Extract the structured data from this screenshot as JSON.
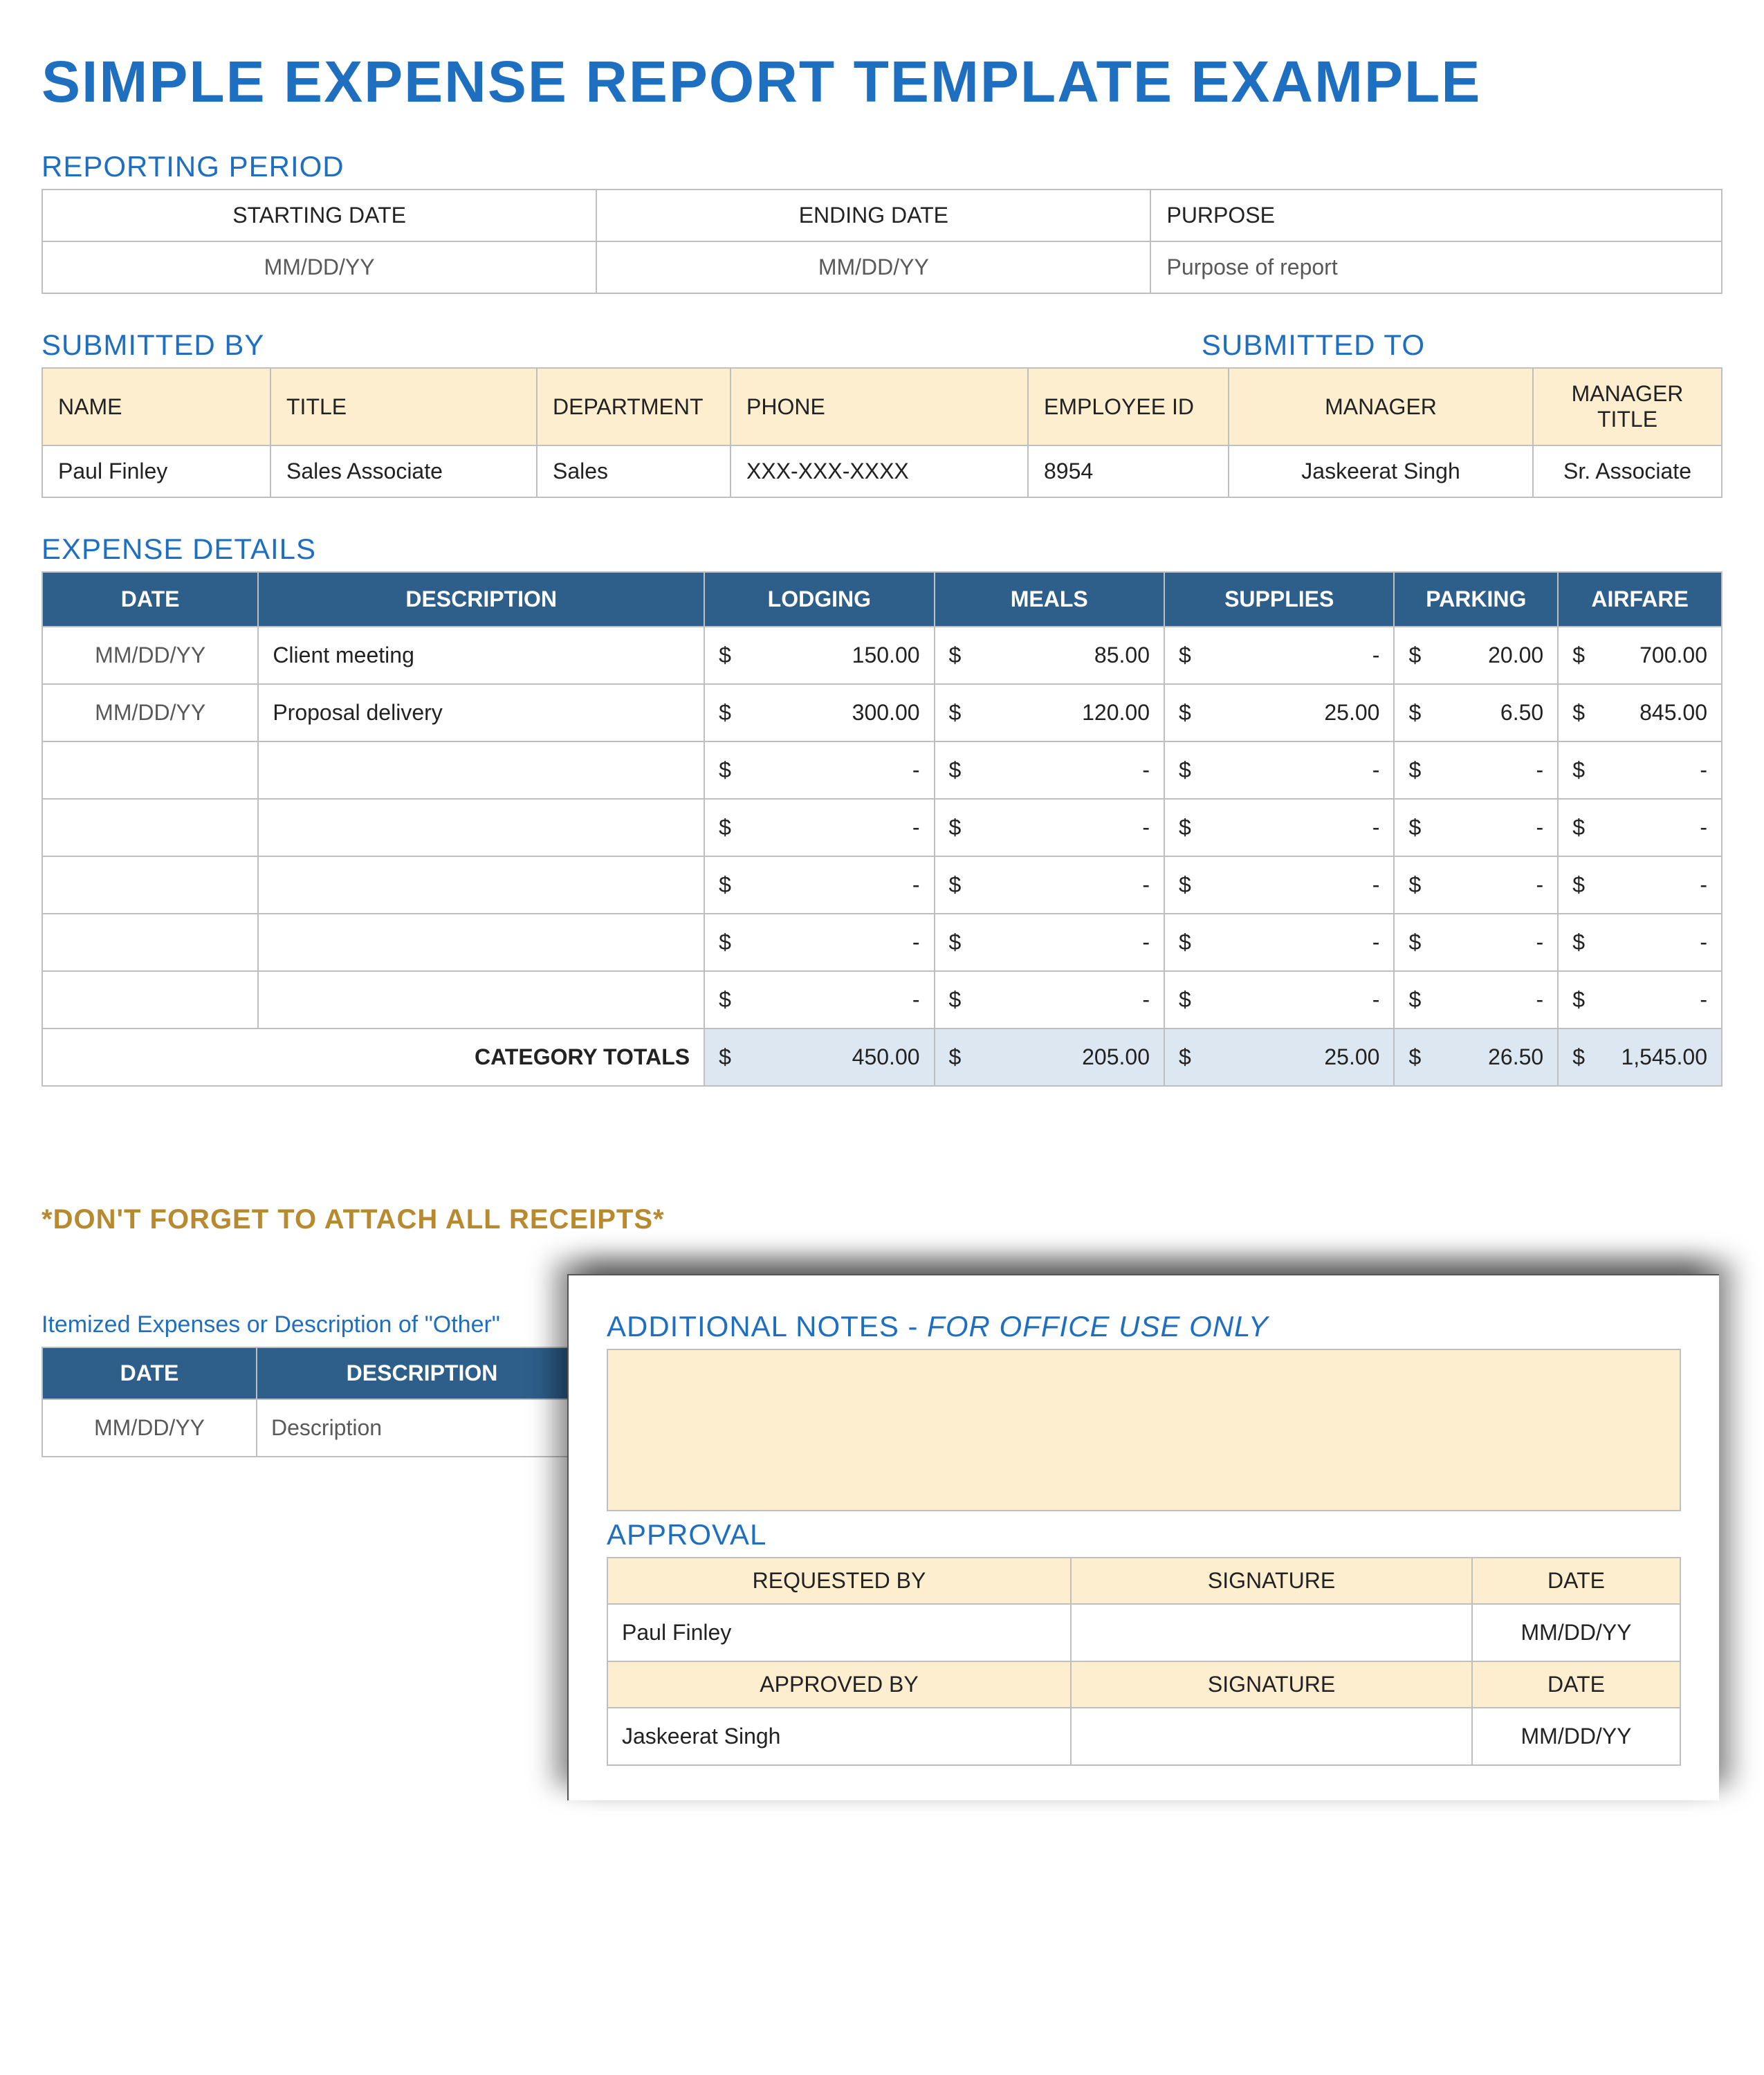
{
  "title": "SIMPLE EXPENSE REPORT TEMPLATE EXAMPLE",
  "reporting_period": {
    "label": "REPORTING PERIOD",
    "headers": {
      "start": "STARTING DATE",
      "end": "ENDING DATE",
      "purpose": "PURPOSE"
    },
    "values": {
      "start": "MM/DD/YY",
      "end": "MM/DD/YY",
      "purpose": "Purpose of report"
    }
  },
  "submitted": {
    "by_label": "SUBMITTED BY",
    "to_label": "SUBMITTED TO",
    "headers": {
      "name": "NAME",
      "title": "TITLE",
      "department": "DEPARTMENT",
      "phone": "PHONE",
      "employee_id": "EMPLOYEE ID",
      "manager": "MANAGER",
      "manager_title": "MANAGER TITLE"
    },
    "values": {
      "name": "Paul Finley",
      "title": "Sales Associate",
      "department": "Sales",
      "phone": "XXX-XXX-XXXX",
      "employee_id": "8954",
      "manager": "Jaskeerat Singh",
      "manager_title": "Sr. Associate"
    }
  },
  "expense": {
    "label": "EXPENSE DETAILS",
    "columns": [
      "DATE",
      "DESCRIPTION",
      "LODGING",
      "MEALS",
      "SUPPLIES",
      "PARKING",
      "AIRFARE"
    ],
    "rows": [
      {
        "date": "MM/DD/YY",
        "desc": "Client meeting",
        "lodging": "150.00",
        "meals": "85.00",
        "supplies": "-",
        "parking": "20.00",
        "airfare": "700.00"
      },
      {
        "date": "MM/DD/YY",
        "desc": "Proposal delivery",
        "lodging": "300.00",
        "meals": "120.00",
        "supplies": "25.00",
        "parking": "6.50",
        "airfare": "845.00"
      },
      {
        "date": "",
        "desc": "",
        "lodging": "-",
        "meals": "-",
        "supplies": "-",
        "parking": "-",
        "airfare": "-"
      },
      {
        "date": "",
        "desc": "",
        "lodging": "-",
        "meals": "-",
        "supplies": "-",
        "parking": "-",
        "airfare": "-"
      },
      {
        "date": "",
        "desc": "",
        "lodging": "-",
        "meals": "-",
        "supplies": "-",
        "parking": "-",
        "airfare": "-"
      },
      {
        "date": "",
        "desc": "",
        "lodging": "-",
        "meals": "-",
        "supplies": "-",
        "parking": "-",
        "airfare": "-"
      },
      {
        "date": "",
        "desc": "",
        "lodging": "-",
        "meals": "-",
        "supplies": "-",
        "parking": "-",
        "airfare": "-"
      }
    ],
    "totals_label": "CATEGORY TOTALS",
    "totals": {
      "lodging": "450.00",
      "meals": "205.00",
      "supplies": "25.00",
      "parking": "26.50",
      "airfare": "1,545.00"
    }
  },
  "receipts_note": "*DON'T FORGET TO ATTACH ALL RECEIPTS*",
  "itemized": {
    "note": "Itemized Expenses or Description of \"Other\"",
    "columns": [
      "DATE",
      "DESCRIPTION"
    ],
    "row": {
      "date": "MM/DD/YY",
      "desc": "Description"
    }
  },
  "popup": {
    "notes_label_a": "ADDITIONAL NOTES - ",
    "notes_label_b": "FOR OFFICE USE ONLY",
    "approval_label": "APPROVAL",
    "headers1": {
      "requested_by": "REQUESTED BY",
      "signature": "SIGNATURE",
      "date": "DATE"
    },
    "values1": {
      "requested_by": "Paul Finley",
      "signature": "",
      "date": "MM/DD/YY"
    },
    "headers2": {
      "approved_by": "APPROVED BY",
      "signature": "SIGNATURE",
      "date": "DATE"
    },
    "values2": {
      "approved_by": "Jaskeerat Singh",
      "signature": "",
      "date": "MM/DD/YY"
    }
  },
  "currency": "$"
}
